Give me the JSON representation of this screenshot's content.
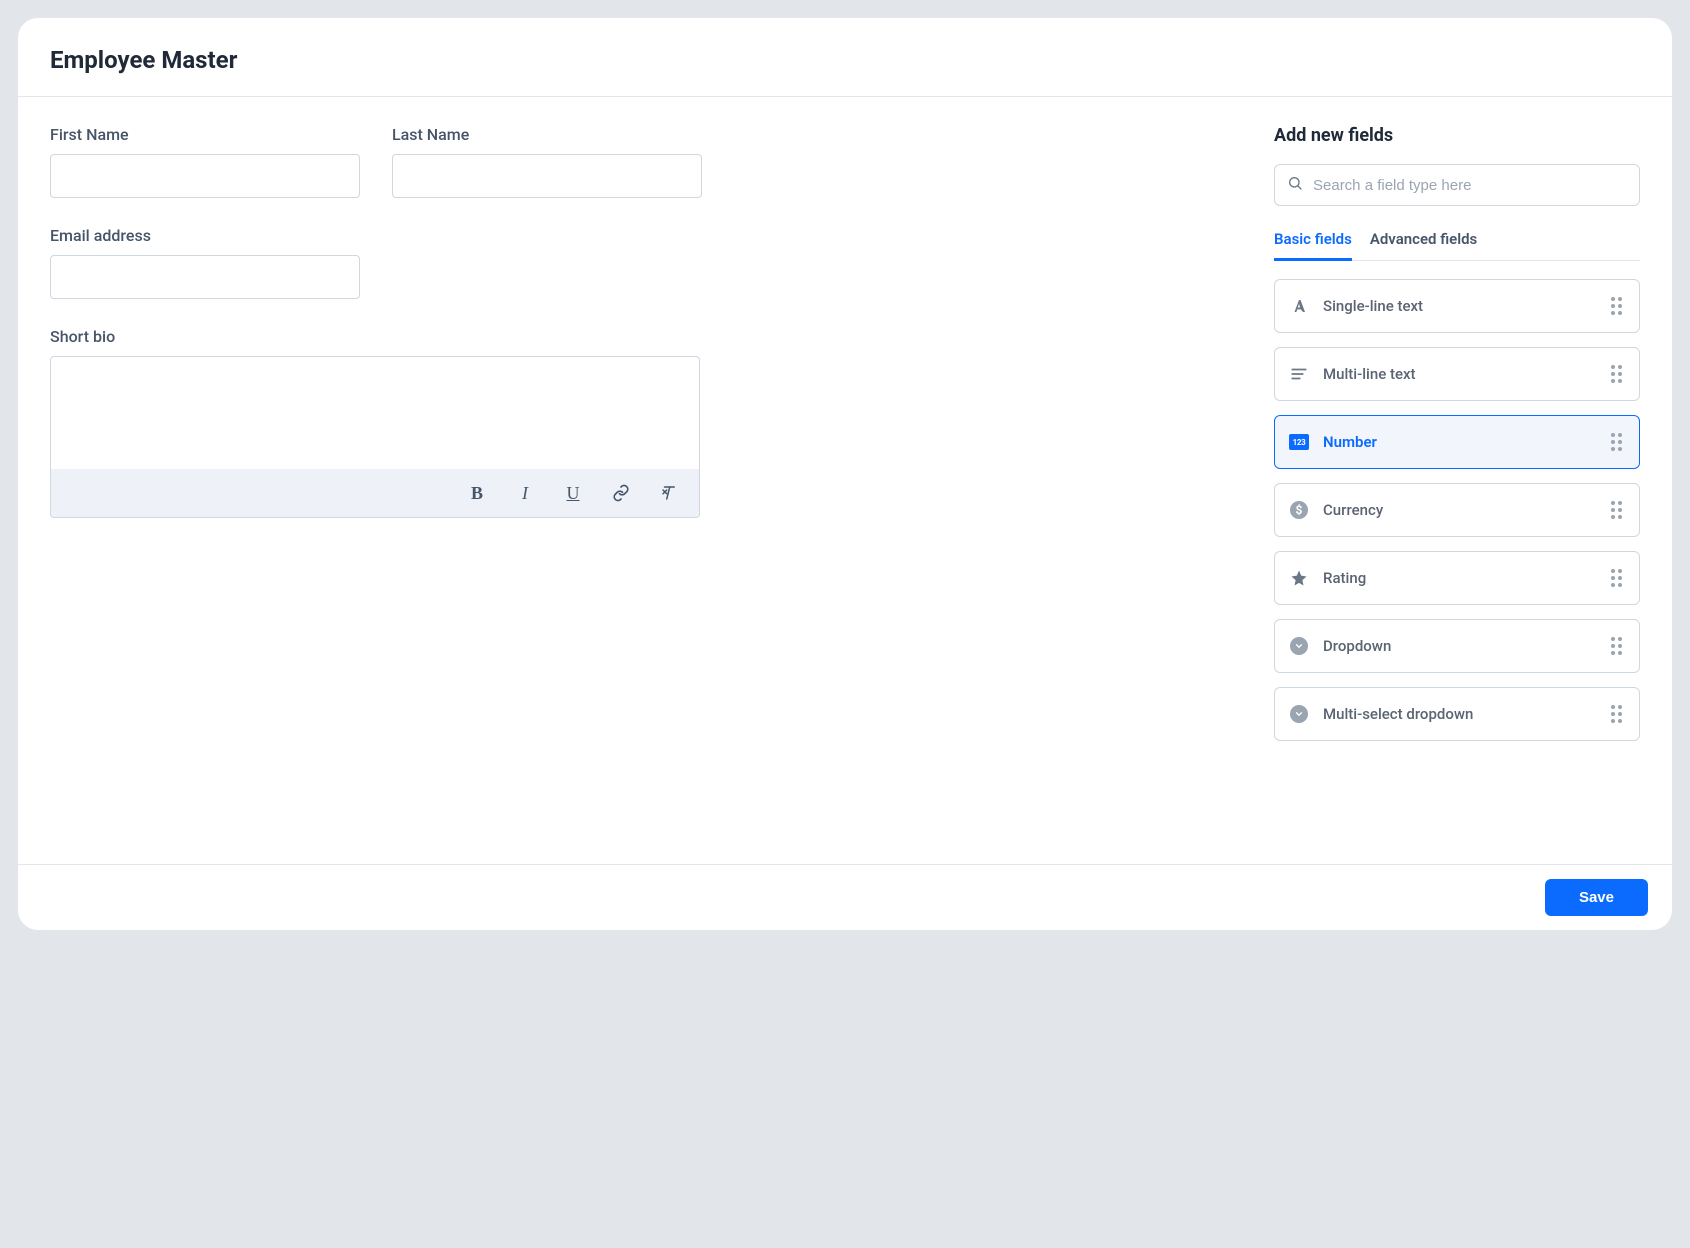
{
  "header": {
    "title": "Employee Master"
  },
  "form": {
    "first_name": {
      "label": "First Name",
      "value": ""
    },
    "last_name": {
      "label": "Last Name",
      "value": ""
    },
    "email": {
      "label": "Email address",
      "value": ""
    },
    "bio": {
      "label": "Short bio",
      "value": ""
    }
  },
  "rte": {
    "bold": "B",
    "italic": "I",
    "underline": "U",
    "link": "link",
    "clear": "clear"
  },
  "sidebar": {
    "title": "Add new fields",
    "search_placeholder": "Search a field type here",
    "tabs": [
      {
        "label": "Basic fields",
        "active": true
      },
      {
        "label": "Advanced fields",
        "active": false
      }
    ],
    "fields": [
      {
        "icon": "text",
        "label": "Single-line text",
        "selected": false
      },
      {
        "icon": "multiline",
        "label": "Multi-line text",
        "selected": false
      },
      {
        "icon": "number",
        "label": "Number",
        "selected": true
      },
      {
        "icon": "currency",
        "label": "Currency",
        "selected": false
      },
      {
        "icon": "rating",
        "label": "Rating",
        "selected": false
      },
      {
        "icon": "dropdown",
        "label": "Dropdown",
        "selected": false
      },
      {
        "icon": "multiselect",
        "label": "Multi-select dropdown",
        "selected": false
      }
    ]
  },
  "footer": {
    "save_label": "Save"
  }
}
